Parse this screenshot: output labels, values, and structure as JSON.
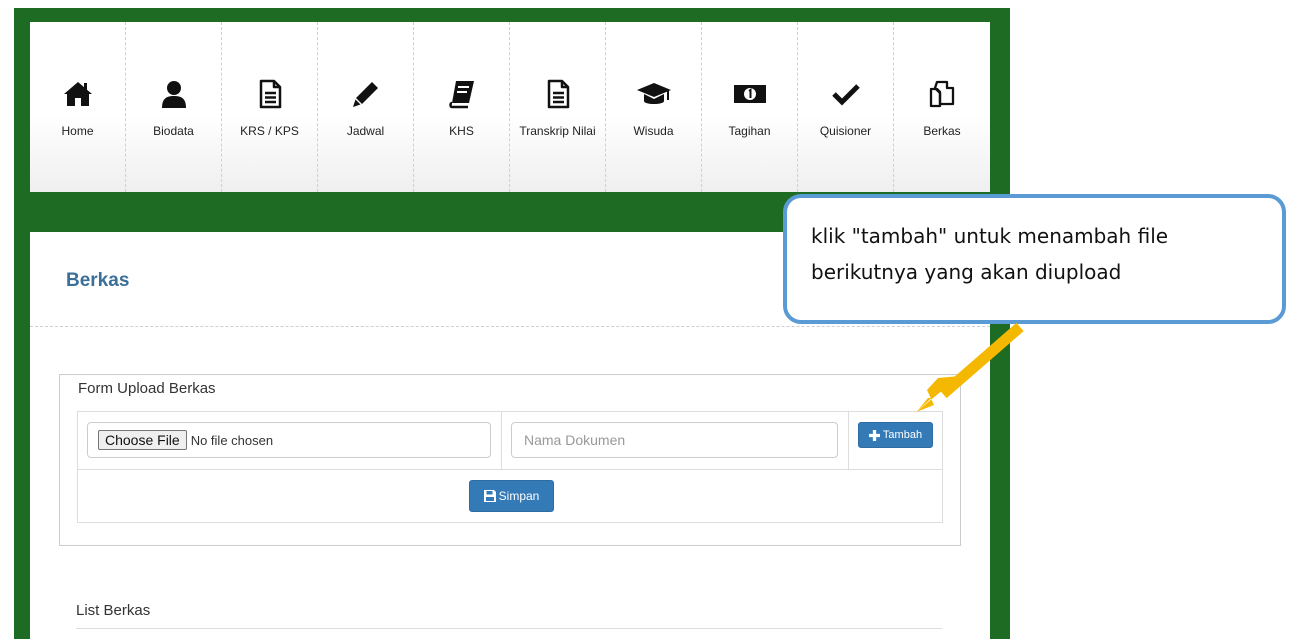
{
  "nav": {
    "items": [
      {
        "label": "Home",
        "icon": "home-icon"
      },
      {
        "label": "Biodata",
        "icon": "user-icon"
      },
      {
        "label": "KRS / KPS",
        "icon": "file-text-icon"
      },
      {
        "label": "Jadwal",
        "icon": "pencil-icon"
      },
      {
        "label": "KHS",
        "icon": "book-icon"
      },
      {
        "label": "Transkrip Nilai",
        "icon": "file-text-icon"
      },
      {
        "label": "Wisuda",
        "icon": "graduation-cap-icon"
      },
      {
        "label": "Tagihan",
        "icon": "money-icon"
      },
      {
        "label": "Quisioner",
        "icon": "check-icon"
      },
      {
        "label": "Berkas",
        "icon": "files-icon"
      }
    ]
  },
  "page": {
    "title": "Berkas"
  },
  "form": {
    "legend": "Form Upload Berkas",
    "choose_file_label": "Choose File",
    "no_file_text": "No file chosen",
    "name_placeholder": "Nama Dokumen",
    "add_label": "Tambah",
    "save_label": "Simpan"
  },
  "list": {
    "title": "List Berkas"
  },
  "callout": {
    "text": "klik \"tambah\" untuk menambah file berikutnya yang akan diupload"
  },
  "colors": {
    "frame_green": "#1e6b23",
    "primary_blue": "#337ab7",
    "title_blue": "#3a6f9a",
    "callout_border": "#5b9bd5",
    "arrow_yellow": "#f5b800"
  }
}
